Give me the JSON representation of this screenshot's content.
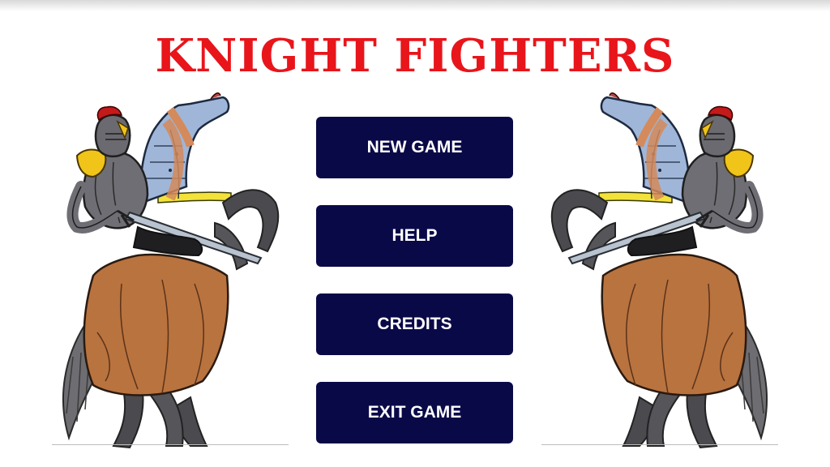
{
  "title": "KNIGHT FIGHTERS",
  "menu": {
    "new_game": "NEW GAME",
    "help": "HELP",
    "credits": "CREDITS",
    "exit_game": "EXIT GAME"
  },
  "colors": {
    "title": "#e8151b",
    "button_bg": "#0a0948",
    "button_text": "#ffffff"
  }
}
